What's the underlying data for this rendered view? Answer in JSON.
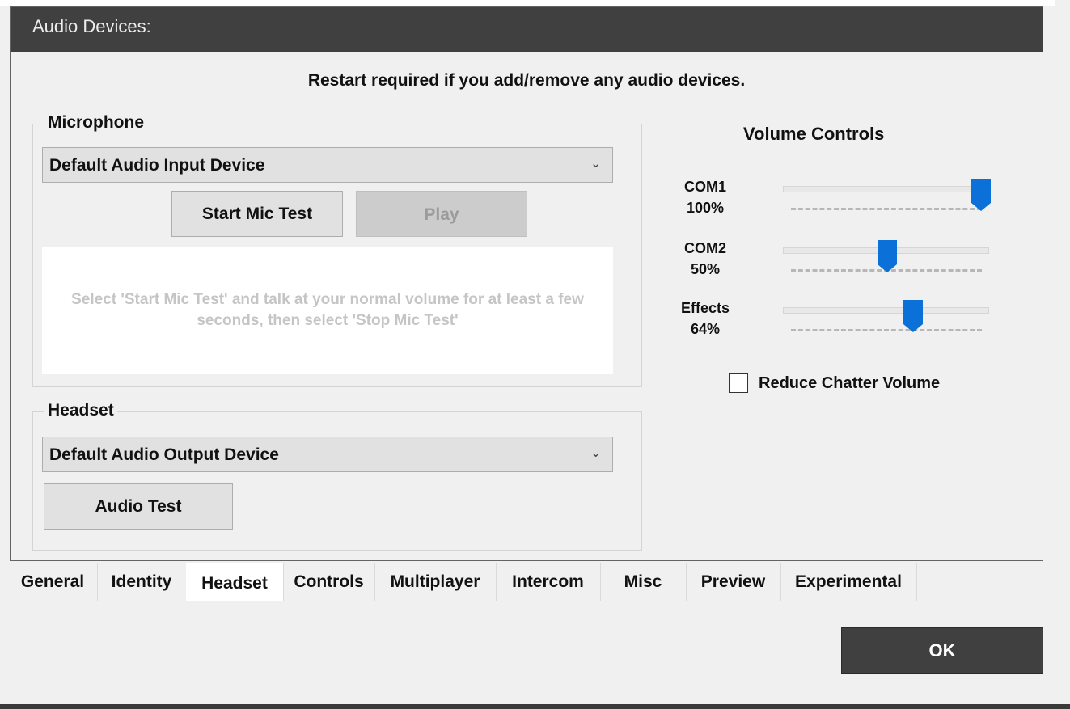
{
  "window": {
    "title": "Audio Devices:",
    "restart_note": "Restart required if you add/remove any audio devices."
  },
  "microphone": {
    "legend": "Microphone",
    "device": "Default Audio Input Device",
    "start_test_label": "Start Mic Test",
    "play_label": "Play",
    "info_text": "Select 'Start Mic Test' and talk at your normal volume for at least a few seconds, then select 'Stop Mic Test'"
  },
  "headset": {
    "legend": "Headset",
    "device": "Default Audio Output Device",
    "audio_test_label": "Audio Test"
  },
  "volume": {
    "title": "Volume Controls",
    "sliders": [
      {
        "name": "COM1",
        "value_label": "100%",
        "value": 100
      },
      {
        "name": "COM2",
        "value_label": "50%",
        "value": 50
      },
      {
        "name": "Effects",
        "value_label": "64%",
        "value": 64
      }
    ],
    "reduce_chatter_label": "Reduce Chatter Volume",
    "reduce_chatter_checked": false,
    "thumb_color": "#0b70d8"
  },
  "tabs": [
    {
      "label": "General",
      "active": false
    },
    {
      "label": "Identity",
      "active": false
    },
    {
      "label": "Headset",
      "active": true
    },
    {
      "label": "Controls",
      "active": false
    },
    {
      "label": "Multiplayer",
      "active": false
    },
    {
      "label": "Intercom",
      "active": false
    },
    {
      "label": "Misc",
      "active": false
    },
    {
      "label": "Preview",
      "active": false
    },
    {
      "label": "Experimental",
      "active": false
    }
  ],
  "footer": {
    "ok_label": "OK"
  },
  "icons": {
    "dropdown": "chevron-down-icon"
  }
}
